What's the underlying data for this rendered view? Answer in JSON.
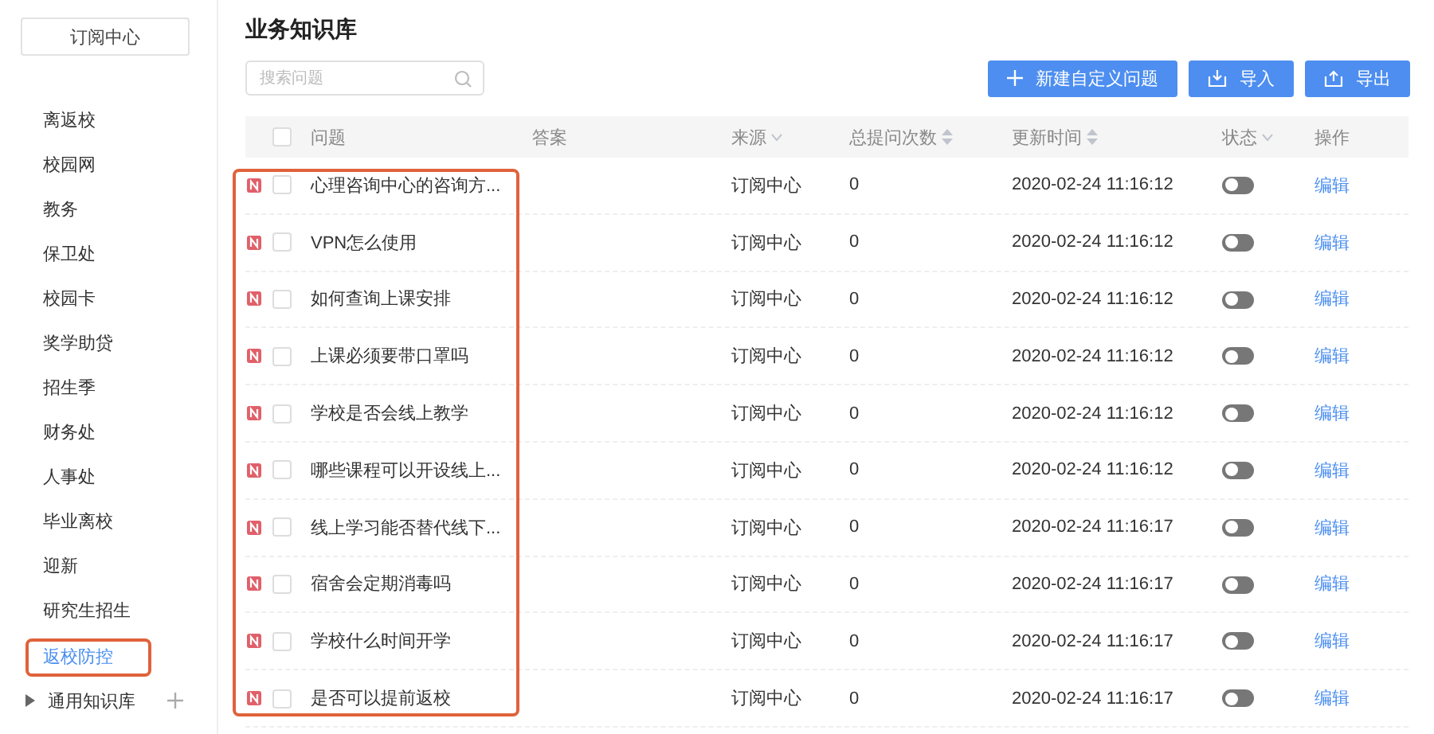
{
  "sidebar": {
    "top_button": "订阅中心",
    "items": [
      {
        "label": "离返校",
        "selected": false
      },
      {
        "label": "校园网",
        "selected": false
      },
      {
        "label": "教务",
        "selected": false
      },
      {
        "label": "保卫处",
        "selected": false
      },
      {
        "label": "校园卡",
        "selected": false
      },
      {
        "label": "奖学助贷",
        "selected": false
      },
      {
        "label": "招生季",
        "selected": false
      },
      {
        "label": "财务处",
        "selected": false
      },
      {
        "label": "人事处",
        "selected": false
      },
      {
        "label": "毕业离校",
        "selected": false
      },
      {
        "label": "迎新",
        "selected": false
      },
      {
        "label": "研究生招生",
        "selected": false
      },
      {
        "label": "返校防控",
        "selected": true
      }
    ],
    "tree": {
      "label": "通用知识库",
      "expanded": false
    }
  },
  "title": "业务知识库",
  "search": {
    "placeholder": "搜索问题"
  },
  "buttons": [
    {
      "label": "新建自定义问题",
      "kind": "add"
    },
    {
      "label": "导入",
      "kind": "import"
    },
    {
      "label": "导出",
      "kind": "export"
    }
  ],
  "table": {
    "header_checked": false,
    "columns": [
      {
        "label": "问题",
        "kind": "plain"
      },
      {
        "label": "答案",
        "kind": "plain"
      },
      {
        "label": "来源",
        "kind": "filter"
      },
      {
        "label": "总提问次数",
        "kind": "sort"
      },
      {
        "label": "更新时间",
        "kind": "sort"
      },
      {
        "label": "状态",
        "kind": "filter"
      },
      {
        "label": "操作",
        "kind": "plain"
      }
    ],
    "rows": [
      {
        "question": "心理咨询中心的咨询方...",
        "source": "订阅中心",
        "count": "0",
        "updated": "2020-02-24 11:16:12",
        "on": false,
        "checked": false,
        "action": "编辑"
      },
      {
        "question": "VPN怎么使用",
        "source": "订阅中心",
        "count": "0",
        "updated": "2020-02-24 11:16:12",
        "on": false,
        "checked": false,
        "action": "编辑"
      },
      {
        "question": "如何查询上课安排",
        "source": "订阅中心",
        "count": "0",
        "updated": "2020-02-24 11:16:12",
        "on": false,
        "checked": false,
        "action": "编辑"
      },
      {
        "question": "上课必须要带口罩吗",
        "source": "订阅中心",
        "count": "0",
        "updated": "2020-02-24 11:16:12",
        "on": false,
        "checked": false,
        "action": "编辑"
      },
      {
        "question": "学校是否会线上教学",
        "source": "订阅中心",
        "count": "0",
        "updated": "2020-02-24 11:16:12",
        "on": false,
        "checked": false,
        "action": "编辑"
      },
      {
        "question": "哪些课程可以开设线上...",
        "source": "订阅中心",
        "count": "0",
        "updated": "2020-02-24 11:16:12",
        "on": false,
        "checked": false,
        "action": "编辑"
      },
      {
        "question": "线上学习能否替代线下...",
        "source": "订阅中心",
        "count": "0",
        "updated": "2020-02-24 11:16:17",
        "on": false,
        "checked": false,
        "action": "编辑"
      },
      {
        "question": "宿舍会定期消毒吗",
        "source": "订阅中心",
        "count": "0",
        "updated": "2020-02-24 11:16:17",
        "on": false,
        "checked": false,
        "action": "编辑"
      },
      {
        "question": "学校什么时间开学",
        "source": "订阅中心",
        "count": "0",
        "updated": "2020-02-24 11:16:17",
        "on": false,
        "checked": false,
        "action": "编辑"
      },
      {
        "question": "是否可以提前返校",
        "source": "订阅中心",
        "count": "0",
        "updated": "2020-02-24 11:16:17",
        "on": false,
        "checked": false,
        "action": "编辑"
      }
    ]
  }
}
